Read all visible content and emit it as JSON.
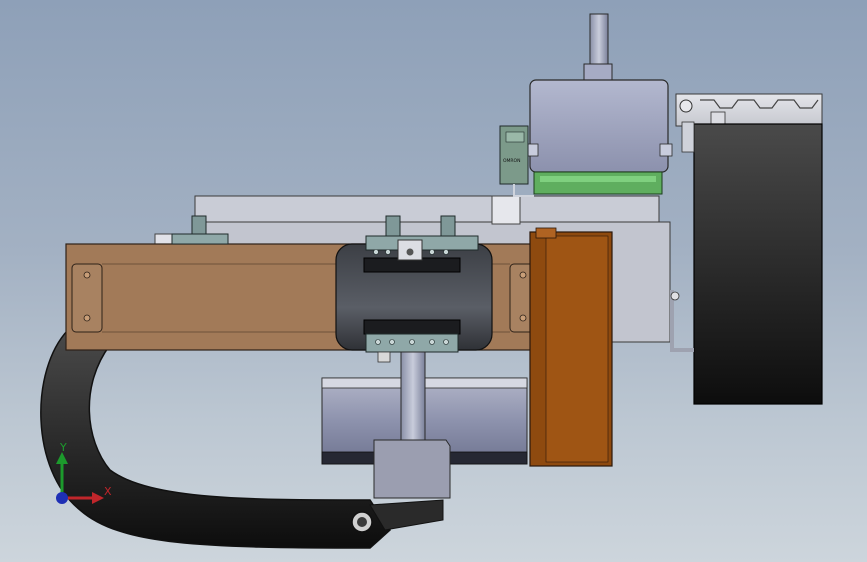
{
  "viewport": {
    "background_top": "#8ea0b8",
    "background_bottom": "#cdd5dc"
  },
  "parts": {
    "sensor_label": "OMRON"
  },
  "triad": {
    "x_label": "X",
    "y_label": "Y",
    "x_color": "#c0262b",
    "y_color": "#1c9a2c",
    "z_color": "#1e2fb5"
  }
}
